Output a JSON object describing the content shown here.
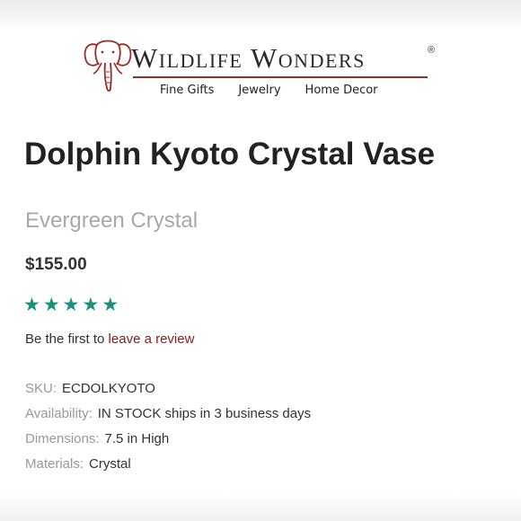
{
  "header": {
    "brand_name": "Wildlife Wonders",
    "registered_mark": "®",
    "accent_color": "#9b2a2a",
    "logo_icon": "elephant-icon",
    "nav": [
      {
        "label": "Fine Gifts"
      },
      {
        "label": "Jewelry"
      },
      {
        "label": "Home Decor"
      }
    ]
  },
  "product": {
    "title": "Dolphin Kyoto Crystal Vase",
    "brand": "Evergreen Crystal",
    "price": "$155.00",
    "rating": {
      "stars_shown": 5,
      "star_color": "#1a9179",
      "icon": "star-icon"
    },
    "review_prompt": "Be the first to",
    "review_link": "leave a review",
    "review_link_color": "#8b1c1c",
    "specs": [
      {
        "label": "SKU:",
        "value": "ECDOLKYOTO"
      },
      {
        "label": "Availability:",
        "value": "IN STOCK ships in 3 business days"
      },
      {
        "label": "Dimensions:",
        "value": "7.5 in High"
      },
      {
        "label": "Materials:",
        "value": "Crystal"
      }
    ]
  }
}
